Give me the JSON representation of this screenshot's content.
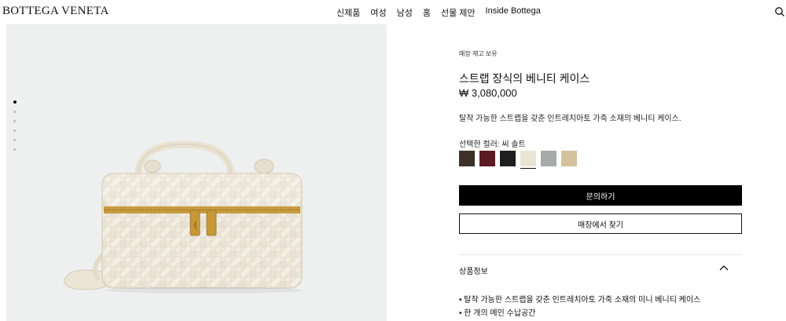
{
  "header": {
    "logo": "BOTTEGA VENETA",
    "nav": [
      "신제품",
      "여성",
      "남성",
      "홈",
      "선물 제안",
      "Inside Bottega"
    ]
  },
  "gallery": {
    "image_count": 6,
    "active_index": 0
  },
  "product": {
    "stock_status": "매장 재고 보유",
    "title": "스트랩 장식의 베니티 케이스",
    "price": "₩ 3,080,000",
    "description": "탈착 가능한 스트랩을 갖춘 인트레치아토 가죽 소재의 베니티 케이스.",
    "color_label": "선택한 컬러: 씨 솔트",
    "swatches": [
      {
        "name": "dark-brown",
        "color": "#3b3128"
      },
      {
        "name": "burgundy",
        "color": "#5c1a22"
      },
      {
        "name": "black",
        "color": "#1e1e1e"
      },
      {
        "name": "sea-salt",
        "color": "#ebe4d4"
      },
      {
        "name": "grey",
        "color": "#a6aaa8"
      },
      {
        "name": "beige",
        "color": "#d4c29c"
      }
    ],
    "selected_swatch": 3,
    "inquire_button": "문의하기",
    "find_store_button": "매장에서 찾기",
    "details_title": "상품정보",
    "details": [
      "• 탈착 가능한 스트랩을 갖춘 인트레치아토 가죽 소재의 미니 베니티 케이스",
      "• 한 개의 메인 수납공간"
    ]
  },
  "colors": {
    "image_bg": "#eef0ef",
    "leather": "#efe9dc",
    "zip": "#c99b3e",
    "primary_button": "#000000"
  }
}
